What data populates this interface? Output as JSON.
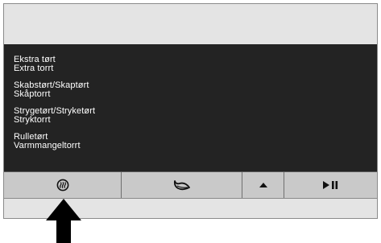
{
  "programs": [
    {
      "line1": "Ekstra tørt",
      "line2": "Extra torrt"
    },
    {
      "line1": "Skabstørt/Skaptørt",
      "line2": "Skåptorrt"
    },
    {
      "line1": "Strygetørt/Stryketørt",
      "line2": "Stryktorrt"
    },
    {
      "line1": "Rulletørt",
      "line2": "Varmmangeltorrt"
    }
  ],
  "buttons": [
    {
      "icon": "heat-symbol-icon"
    },
    {
      "icon": "delicate-leaf-icon"
    },
    {
      "icon": "arrow-up-icon"
    },
    {
      "icon": "play-pause-icon"
    }
  ],
  "colors": {
    "display_bg": "#232323",
    "display_text": "#ffffff",
    "panel_bg": "#e4e4e4",
    "button_bg": "#c9c9c9"
  }
}
